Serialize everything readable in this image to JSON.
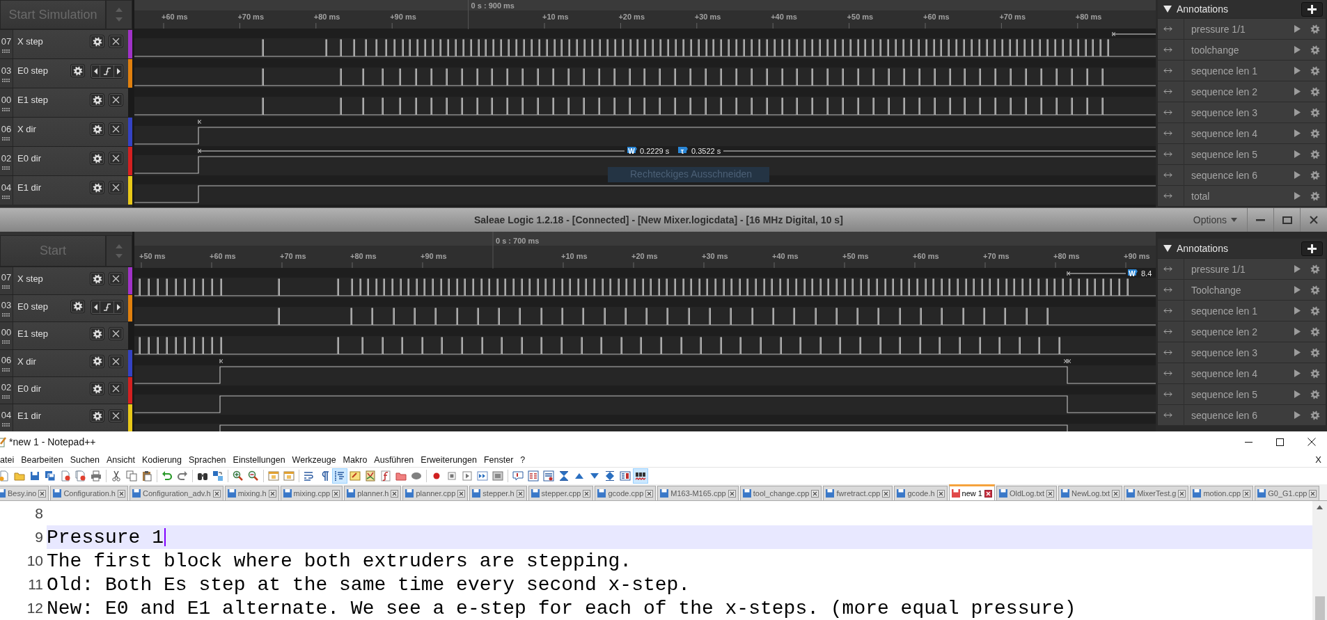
{
  "panes": [
    {
      "start_button": "Start Simulation",
      "ticks": [
        {
          "label": "+60 ms",
          "kind": "tick"
        },
        {
          "label": "+70 ms",
          "kind": "tick"
        },
        {
          "label": "+80 ms",
          "kind": "tick"
        },
        {
          "label": "+90 ms",
          "kind": "tick"
        },
        {
          "label": "0 s : 900 ms",
          "kind": "origin"
        },
        {
          "label": "+10 ms",
          "kind": "tick"
        },
        {
          "label": "+20 ms",
          "kind": "tick"
        },
        {
          "label": "+30 ms",
          "kind": "tick"
        },
        {
          "label": "+40 ms",
          "kind": "tick"
        },
        {
          "label": "+50 ms",
          "kind": "tick"
        },
        {
          "label": "+60 ms",
          "kind": "tick"
        },
        {
          "label": "+70 ms",
          "kind": "tick"
        },
        {
          "label": "+80 ms",
          "kind": "tick"
        }
      ],
      "channels": [
        {
          "number": "07",
          "name": "X step",
          "color": "#a032c8",
          "trigger": false
        },
        {
          "number": "03",
          "name": "E0 step",
          "color": "#e0800e",
          "trigger": true
        },
        {
          "number": "00",
          "name": "E1 step",
          "color": "#1a1a1a",
          "trigger": false
        },
        {
          "number": "06",
          "name": "X dir",
          "color": "#3442c4",
          "trigger": false
        },
        {
          "number": "02",
          "name": "E0 dir",
          "color": "#d42020",
          "trigger": false
        },
        {
          "number": "04",
          "name": "E1 dir",
          "color": "#e8c818",
          "trigger": false
        }
      ],
      "measurements": [
        {
          "symbol": "W",
          "value": "0.2229 s"
        },
        {
          "symbol": "τ",
          "value": "0.3522 s"
        }
      ],
      "overlay_tooltip": "Rechteckiges Ausschneiden",
      "annotations": {
        "title": "Annotations",
        "items": [
          {
            "label": "pressure 1/1"
          },
          {
            "label": "toolchange"
          },
          {
            "label": "sequence len 1"
          },
          {
            "label": "sequence len 2"
          },
          {
            "label": "sequence len 3"
          },
          {
            "label": "sequence len 4"
          },
          {
            "label": "sequence len 5"
          },
          {
            "label": "sequence len 6"
          },
          {
            "label": "total"
          }
        ]
      }
    },
    {
      "start_button": "Start",
      "ticks": [
        {
          "label": "+50 ms",
          "kind": "tick"
        },
        {
          "label": "+60 ms",
          "kind": "tick"
        },
        {
          "label": "+70 ms",
          "kind": "tick"
        },
        {
          "label": "+80 ms",
          "kind": "tick"
        },
        {
          "label": "+90 ms",
          "kind": "tick"
        },
        {
          "label": "0 s : 700 ms",
          "kind": "origin"
        },
        {
          "label": "+10 ms",
          "kind": "tick"
        },
        {
          "label": "+20 ms",
          "kind": "tick"
        },
        {
          "label": "+30 ms",
          "kind": "tick"
        },
        {
          "label": "+40 ms",
          "kind": "tick"
        },
        {
          "label": "+50 ms",
          "kind": "tick"
        },
        {
          "label": "+60 ms",
          "kind": "tick"
        },
        {
          "label": "+70 ms",
          "kind": "tick"
        },
        {
          "label": "+80 ms",
          "kind": "tick"
        },
        {
          "label": "+90 ms",
          "kind": "tick"
        }
      ],
      "channels": [
        {
          "number": "07",
          "name": "X step",
          "color": "#a032c8",
          "trigger": false
        },
        {
          "number": "03",
          "name": "E0 step",
          "color": "#e0800e",
          "trigger": true
        },
        {
          "number": "00",
          "name": "E1 step",
          "color": "#1a1a1a",
          "trigger": false
        },
        {
          "number": "06",
          "name": "X dir",
          "color": "#3442c4",
          "trigger": false
        },
        {
          "number": "02",
          "name": "E0 dir",
          "color": "#d42020",
          "trigger": false
        },
        {
          "number": "04",
          "name": "E1 dir",
          "color": "#e8c818",
          "trigger": false
        }
      ],
      "measurements": [
        {
          "symbol": "W",
          "value": "8.4"
        }
      ],
      "annotations": {
        "title": "Annotations",
        "items": [
          {
            "label": "pressure 1/1"
          },
          {
            "label": "Toolchange"
          },
          {
            "label": "sequence len 1"
          },
          {
            "label": "sequence len 2"
          },
          {
            "label": "sequence len 3"
          },
          {
            "label": "sequence len 4"
          },
          {
            "label": "sequence len 5"
          },
          {
            "label": "sequence len 6"
          }
        ]
      }
    }
  ],
  "title_bar": {
    "title": "Saleae Logic 1.2.18 - [Connected] - [New Mixer.logicdata] - [16 MHz Digital, 10 s]",
    "options": "Options"
  },
  "notepad": {
    "title": "*new 1 - Notepad++",
    "menu": [
      "atei",
      "Bearbeiten",
      "Suchen",
      "Ansicht",
      "Kodierung",
      "Sprachen",
      "Einstellungen",
      "Werkzeuge",
      "Makro",
      "Ausführen",
      "Erweiterungen",
      "Fenster",
      "?"
    ],
    "menu_close": "X",
    "toolbar": [
      {
        "pressed": false
      },
      {
        "pressed": false
      },
      {
        "pressed": false
      },
      {
        "pressed": false
      },
      {
        "pressed": false
      },
      {
        "pressed": false
      },
      {
        "pressed": false
      },
      {
        "pressed": false
      },
      {
        "pressed": false
      },
      {
        "pressed": false
      },
      {
        "pressed": false
      },
      {
        "pressed": false
      },
      {
        "pressed": false
      },
      {
        "pressed": false
      },
      {
        "pressed": false
      },
      {
        "pressed": false
      },
      {
        "pressed": false
      },
      {
        "pressed": false
      },
      {
        "pressed": false
      },
      {
        "pressed": false
      },
      {
        "pressed": true
      },
      {
        "pressed": false
      },
      {
        "pressed": false
      },
      {
        "pressed": false
      },
      {
        "pressed": false
      },
      {
        "pressed": false
      },
      {
        "pressed": false
      },
      {
        "pressed": false
      },
      {
        "pressed": false
      },
      {
        "pressed": false
      },
      {
        "pressed": false
      },
      {
        "pressed": false
      },
      {
        "pressed": false
      },
      {
        "pressed": false
      },
      {
        "pressed": false
      },
      {
        "pressed": false
      },
      {
        "pressed": false
      },
      {
        "pressed": false
      },
      {
        "pressed": false
      },
      {
        "pressed": true
      }
    ],
    "tabs": [
      {
        "label": "Besy.ino",
        "selected": false
      },
      {
        "label": "Configuration.h",
        "selected": false
      },
      {
        "label": "Configuration_adv.h",
        "selected": false
      },
      {
        "label": "mixing.h",
        "selected": false
      },
      {
        "label": "mixing.cpp",
        "selected": false
      },
      {
        "label": "planner.h",
        "selected": false
      },
      {
        "label": "planner.cpp",
        "selected": false
      },
      {
        "label": "stepper.h",
        "selected": false
      },
      {
        "label": "stepper.cpp",
        "selected": false
      },
      {
        "label": "gcode.cpp",
        "selected": false
      },
      {
        "label": "M163-M165.cpp",
        "selected": false
      },
      {
        "label": "tool_change.cpp",
        "selected": false
      },
      {
        "label": "fwretract.cpp",
        "selected": false
      },
      {
        "label": "gcode.h",
        "selected": false
      },
      {
        "label": "new 1",
        "selected": true
      },
      {
        "label": "OldLog.txt",
        "selected": false
      },
      {
        "label": "NewLog.txt",
        "selected": false
      },
      {
        "label": "MixerTest.g",
        "selected": false
      },
      {
        "label": "motion.cpp",
        "selected": false
      },
      {
        "label": "G0_G1.cpp",
        "selected": false
      }
    ],
    "lines": [
      {
        "number": "8",
        "current": false
      },
      {
        "number": "9",
        "text": "Pressure 1",
        "current": true
      },
      {
        "number": "10",
        "text": "The first block where both extruders are stepping.",
        "current": false
      },
      {
        "number": "11",
        "text": "Old: Both Es step at the same time every second x-step.",
        "current": false
      },
      {
        "number": "12",
        "text": "New: E0 and E1 alternate. We see a e-step for each of the x-steps. (more equal pressure)",
        "current": false
      }
    ]
  }
}
